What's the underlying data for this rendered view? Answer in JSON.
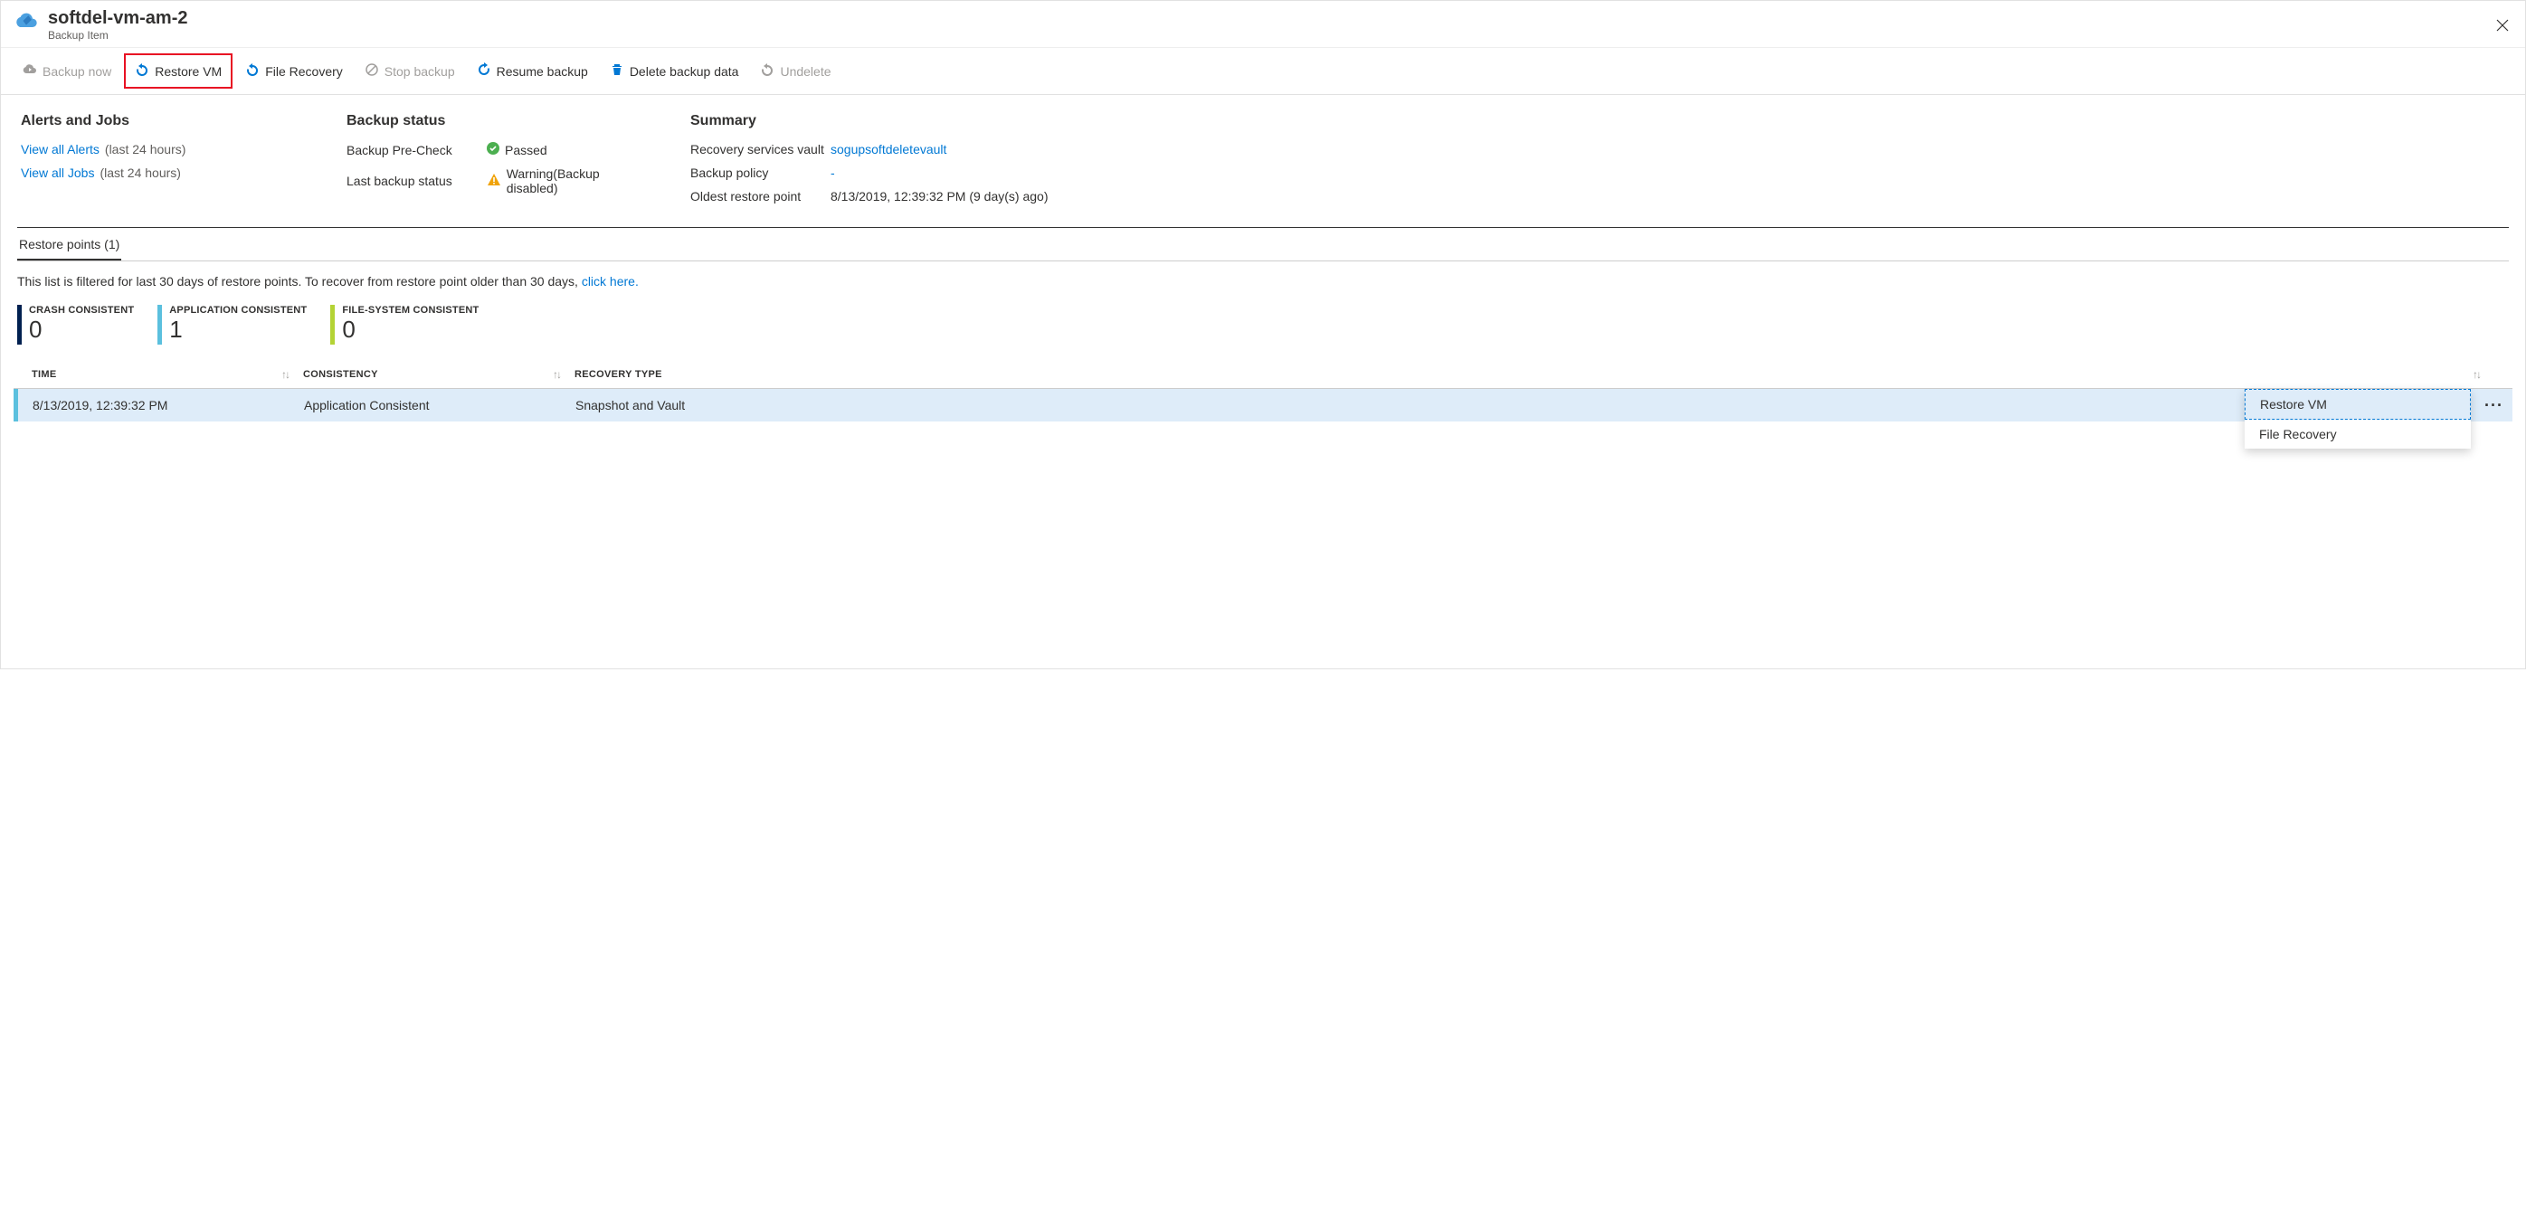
{
  "header": {
    "title": "softdel-vm-am-2",
    "subtitle": "Backup Item"
  },
  "toolbar": {
    "backup_now": "Backup now",
    "restore_vm": "Restore VM",
    "file_recovery": "File Recovery",
    "stop_backup": "Stop backup",
    "resume_backup": "Resume backup",
    "delete_backup_data": "Delete backup data",
    "undelete": "Undelete"
  },
  "alerts_panel": {
    "heading": "Alerts and Jobs",
    "view_alerts": "View all Alerts",
    "view_jobs": "View all Jobs",
    "last24": "(last 24 hours)"
  },
  "backup_status": {
    "heading": "Backup status",
    "precheck_label": "Backup Pre-Check",
    "precheck_value": "Passed",
    "last_label": "Last backup status",
    "last_value": "Warning(Backup disabled)"
  },
  "summary": {
    "heading": "Summary",
    "vault_label": "Recovery services vault",
    "vault_value": "sogupsoftdeletevault",
    "policy_label": "Backup policy",
    "policy_value": "-",
    "oldest_label": "Oldest restore point",
    "oldest_value": "8/13/2019, 12:39:32 PM (9 day(s) ago)"
  },
  "tabs": {
    "restore_points": "Restore points (1)"
  },
  "filter_text": "This list is filtered for last 30 days of restore points. To recover from restore point older than 30 days, ",
  "filter_link": "click here.",
  "stats": {
    "crash_label": "CRASH CONSISTENT",
    "crash_val": "0",
    "app_label": "APPLICATION CONSISTENT",
    "app_val": "1",
    "fs_label": "FILE-SYSTEM CONSISTENT",
    "fs_val": "0"
  },
  "table": {
    "col_time": "TIME",
    "col_cons": "CONSISTENCY",
    "col_rec": "RECOVERY TYPE",
    "rows": [
      {
        "time": "8/13/2019, 12:39:32 PM",
        "consistency": "Application Consistent",
        "recovery": "Snapshot and Vault"
      }
    ]
  },
  "context_menu": {
    "restore_vm": "Restore VM",
    "file_recovery": "File Recovery"
  }
}
